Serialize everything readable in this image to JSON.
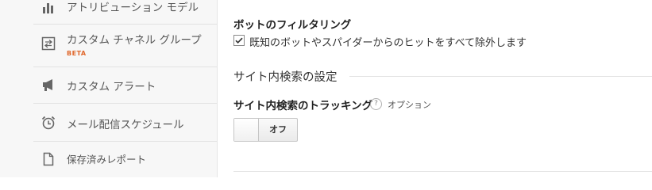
{
  "sidebar": {
    "items": [
      {
        "label": "アトリビューション モデル",
        "icon": "bar-chart-icon"
      },
      {
        "label": "カスタム チャネル グループ",
        "badge": "BETA",
        "icon": "swap-arrows-icon"
      },
      {
        "label": "カスタム アラート",
        "icon": "megaphone-icon"
      },
      {
        "label": "メール配信スケジュール",
        "icon": "alarm-clock-icon"
      },
      {
        "label": "保存済みレポート",
        "icon": "document-icon"
      }
    ]
  },
  "bot_filtering": {
    "heading": "ボットのフィルタリング",
    "checkbox_label": "既知のボットやスパイダーからのヒットをすべて除外します",
    "checked": true
  },
  "site_search": {
    "section_title": "サイト内検索の設定",
    "tracking_heading": "サイト内検索のトラッキング",
    "help_glyph": "?",
    "optional_label": "オプション",
    "toggle_label": "オフ",
    "toggle_on": false
  },
  "colors": {
    "sidebar_bg": "#f7f7f7",
    "beta_badge": "#e0672b",
    "icon": "#666666"
  }
}
